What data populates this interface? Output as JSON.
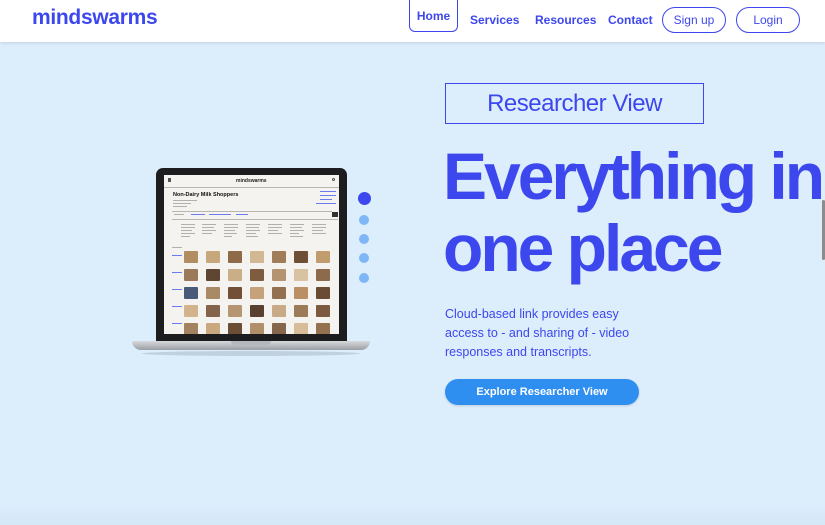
{
  "header": {
    "logo": "mindswarms",
    "nav": [
      "Home",
      "Services",
      "Resources",
      "Contact"
    ],
    "signup_label": "Sign up",
    "login_label": "Login"
  },
  "hero": {
    "tag": "Researcher View",
    "title": "Everything in one place",
    "description": "Cloud-based link provides easy access to - and sharing of - video responses and transcripts.",
    "cta_label": "Explore Researcher View"
  },
  "laptop_screen": {
    "app_logo": "mindswarms",
    "heading": "Non-Dairy Milk Shoppers"
  },
  "carousel": {
    "total": 5,
    "active_index": 0
  },
  "colors": {
    "brand": "#3d47ee",
    "cta": "#2f8ff0",
    "background": "#dcedfc",
    "dot_inactive": "#7fb6f5"
  }
}
